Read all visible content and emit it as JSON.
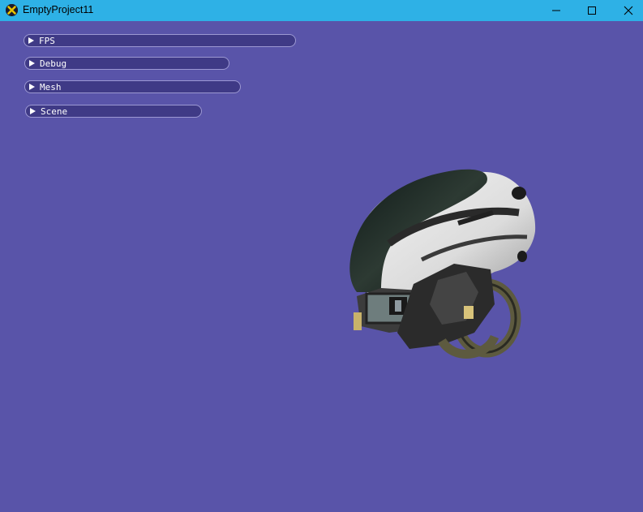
{
  "window": {
    "title": "EmptyProject11",
    "minimize_icon": "minimize-icon",
    "maximize_icon": "maximize-icon",
    "close_icon": "close-icon",
    "app_icon": "directx-logo-icon"
  },
  "panels": [
    {
      "label": "FPS",
      "icon": "collapse-arrow-icon"
    },
    {
      "label": "Debug",
      "icon": "collapse-arrow-icon"
    },
    {
      "label": "Mesh",
      "icon": "collapse-arrow-icon"
    },
    {
      "label": "Scene",
      "icon": "collapse-arrow-icon"
    }
  ],
  "colors": {
    "titlebar": "#2eb1e6",
    "background": "#5954a9",
    "panel_fill": "#3f3a86",
    "panel_border": "#9c98d2"
  }
}
